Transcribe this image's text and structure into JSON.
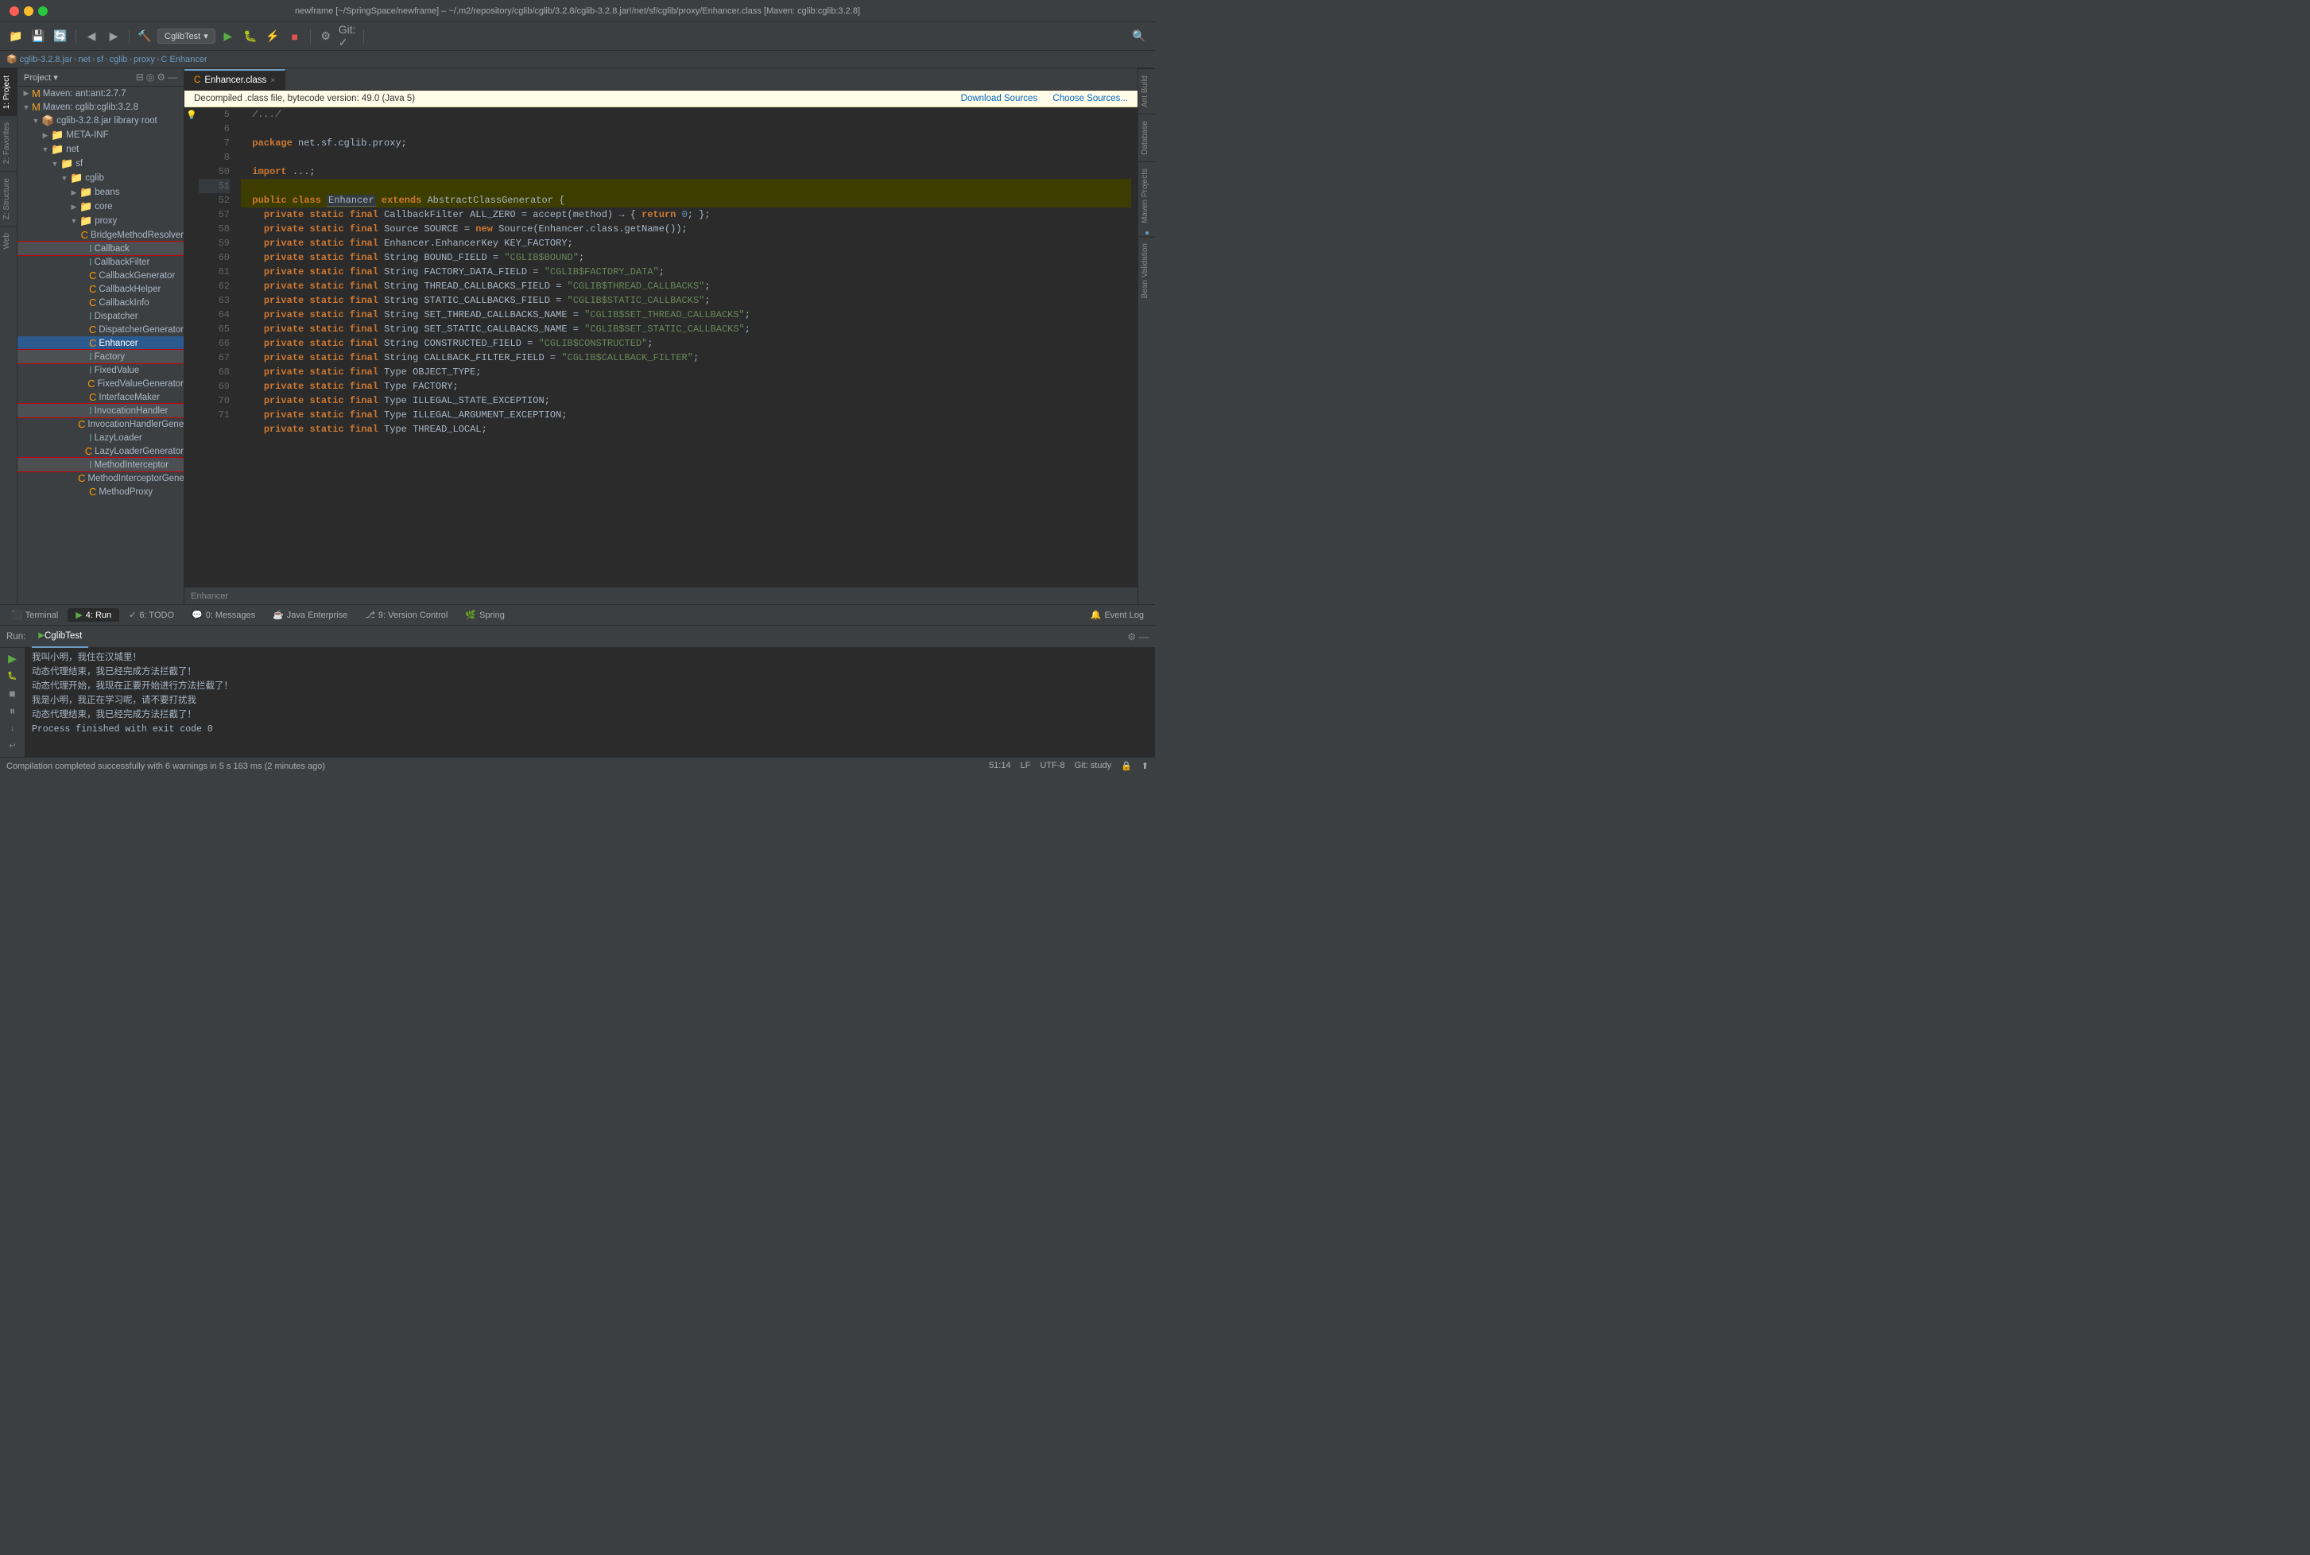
{
  "titleBar": {
    "title": "newframe [~/SpringSpace/newframe] – ~/.m2/repository/cglib/cglib/3.2.8/cglib-3.2.8.jar!/net/sf/cglib/proxy/Enhancer.class [Maven: cglib:cglib:3.2.8]"
  },
  "breadcrumb": {
    "items": [
      "cglib-3.2.8.jar",
      "net",
      "sf",
      "cglib",
      "proxy",
      "Enhancer"
    ]
  },
  "project": {
    "header": "Project",
    "tree": [
      {
        "level": 1,
        "type": "maven",
        "label": "Maven: ant:ant:2.7.7",
        "expanded": false
      },
      {
        "level": 1,
        "type": "maven",
        "label": "Maven: cglib:cglib:3.2.8",
        "expanded": true
      },
      {
        "level": 2,
        "type": "jar",
        "label": "cglib-3.2.8.jar library root",
        "expanded": true
      },
      {
        "level": 3,
        "type": "folder",
        "label": "META-INF",
        "expanded": false
      },
      {
        "level": 3,
        "type": "folder",
        "label": "net",
        "expanded": true
      },
      {
        "level": 4,
        "type": "folder",
        "label": "sf",
        "expanded": true
      },
      {
        "level": 5,
        "type": "folder",
        "label": "cglib",
        "expanded": true
      },
      {
        "level": 6,
        "type": "folder",
        "label": "beans",
        "expanded": false
      },
      {
        "level": 6,
        "type": "folder",
        "label": "core",
        "expanded": false
      },
      {
        "level": 6,
        "type": "folder",
        "label": "proxy",
        "expanded": true
      },
      {
        "level": 7,
        "type": "class",
        "label": "BridgeMethodResolver",
        "expanded": false
      },
      {
        "level": 7,
        "type": "class",
        "label": "Callback",
        "expanded": false,
        "highlighted": true
      },
      {
        "level": 7,
        "type": "class",
        "label": "CallbackFilter",
        "expanded": false
      },
      {
        "level": 7,
        "type": "class",
        "label": "CallbackGenerator",
        "expanded": false
      },
      {
        "level": 7,
        "type": "class",
        "label": "CallbackHelper",
        "expanded": false
      },
      {
        "level": 7,
        "type": "class",
        "label": "CallbackInfo",
        "expanded": false
      },
      {
        "level": 7,
        "type": "class",
        "label": "Dispatcher",
        "expanded": false
      },
      {
        "level": 7,
        "type": "class",
        "label": "DispatcherGenerator",
        "expanded": false
      },
      {
        "level": 7,
        "type": "class",
        "label": "Enhancer",
        "expanded": false,
        "selected": true
      },
      {
        "level": 7,
        "type": "class",
        "label": "Factory",
        "expanded": false,
        "highlighted": true
      },
      {
        "level": 7,
        "type": "class",
        "label": "FixedValue",
        "expanded": false
      },
      {
        "level": 7,
        "type": "class",
        "label": "FixedValueGenerator",
        "expanded": false
      },
      {
        "level": 7,
        "type": "class",
        "label": "InterfaceMaker",
        "expanded": false
      },
      {
        "level": 7,
        "type": "class",
        "label": "InvocationHandler",
        "expanded": false,
        "highlighted": true
      },
      {
        "level": 7,
        "type": "class",
        "label": "InvocationHandlerGenerator",
        "expanded": false
      },
      {
        "level": 7,
        "type": "class",
        "label": "LazyLoader",
        "expanded": false
      },
      {
        "level": 7,
        "type": "class",
        "label": "LazyLoaderGenerator",
        "expanded": false
      },
      {
        "level": 7,
        "type": "class",
        "label": "MethodInterceptor",
        "expanded": false,
        "highlighted": true
      },
      {
        "level": 7,
        "type": "class",
        "label": "MethodInterceptorGenerator",
        "expanded": false
      },
      {
        "level": 7,
        "type": "class",
        "label": "MethodProxy",
        "expanded": false
      }
    ]
  },
  "editor": {
    "tabs": [
      {
        "label": "Enhancer.class",
        "active": true,
        "icon": "class"
      }
    ],
    "notice": {
      "text": "Decompiled .class file, bytecode version: 49.0 (Java 5)",
      "downloadSources": "Download Sources",
      "chooseSources": "Choose Sources..."
    },
    "lines": [
      {
        "num": "",
        "content": "  /.../"
      },
      {
        "num": "5",
        "content": ""
      },
      {
        "num": "6",
        "content": "  package net.sf.cglib.proxy;"
      },
      {
        "num": "7",
        "content": ""
      },
      {
        "num": "8",
        "content": "  import ...;"
      },
      {
        "num": "50",
        "content": ""
      },
      {
        "num": "51",
        "content": "  public class Enhancer extends AbstractClassGenerator {"
      },
      {
        "num": "52",
        "content": "    private static final CallbackFilter ALL_ZERO = accept(method) → { return 0; };"
      },
      {
        "num": "57",
        "content": "    private static final Source SOURCE = new Source(Enhancer.class.getName());"
      },
      {
        "num": "58",
        "content": "    private static final Enhancer.EnhancerKey KEY_FACTORY;"
      },
      {
        "num": "59",
        "content": "    private static final String BOUND_FIELD = \"CGLIB$BOUND\";"
      },
      {
        "num": "60",
        "content": "    private static final String FACTORY_DATA_FIELD = \"CGLIB$FACTORY_DATA\";"
      },
      {
        "num": "61",
        "content": "    private static final String THREAD_CALLBACKS_FIELD = \"CGLIB$THREAD_CALLBACKS\";"
      },
      {
        "num": "62",
        "content": "    private static final String STATIC_CALLBACKS_FIELD = \"CGLIB$STATIC_CALLBACKS\";"
      },
      {
        "num": "63",
        "content": "    private static final String SET_THREAD_CALLBACKS_NAME = \"CGLIB$SET_THREAD_CALLBACKS\";"
      },
      {
        "num": "64",
        "content": "    private static final String SET_STATIC_CALLBACKS_NAME = \"CGLIB$SET_STATIC_CALLBACKS\";"
      },
      {
        "num": "65",
        "content": "    private static final String CONSTRUCTED_FIELD = \"CGLIB$CONSTRUCTED\";"
      },
      {
        "num": "66",
        "content": "    private static final String CALLBACK_FILTER_FIELD = \"CGLIB$CALLBACK_FILTER\";"
      },
      {
        "num": "67",
        "content": "    private static final Type OBJECT_TYPE;"
      },
      {
        "num": "68",
        "content": "    private static final Type FACTORY;"
      },
      {
        "num": "69",
        "content": "    private static final Type ILLEGAL_STATE_EXCEPTION;"
      },
      {
        "num": "70",
        "content": "    private static final Type ILLEGAL_ARGUMENT_EXCEPTION;"
      },
      {
        "num": "71",
        "content": "    private static final Type THREAD_LOCAL;"
      }
    ],
    "breadcrumb": "Enhancer"
  },
  "runPanel": {
    "label": "Run:",
    "tabLabel": "CglibTest",
    "output": [
      "我叫小明，我住在汉城里！",
      "动态代理结束，我已经完成方法拦截了！",
      "动态代理开始，我现在正要开始进行方法拦截了！",
      "我是小明，我正在学习呢，请不要打扰我",
      "动态代理结束，我已经完成方法拦截了！",
      "",
      "Process finished with exit code 0"
    ]
  },
  "bottomTabs": [
    {
      "label": "Terminal",
      "icon": "terminal",
      "active": false
    },
    {
      "label": "4: Run",
      "icon": "run",
      "active": true
    },
    {
      "label": "6: TODO",
      "icon": "todo",
      "active": false
    },
    {
      "label": "0: Messages",
      "icon": "messages",
      "active": false
    },
    {
      "label": "Java Enterprise",
      "icon": "java",
      "active": false
    },
    {
      "label": "9: Version Control",
      "icon": "git",
      "active": false
    },
    {
      "label": "Spring",
      "icon": "spring",
      "active": false
    }
  ],
  "statusBar": {
    "message": "Compilation completed successfully with 6 warnings in 5 s 163 ms (2 minutes ago)",
    "position": "51:14",
    "encoding": "UTF-8",
    "lineSeparator": "LF",
    "vcs": "Git: study"
  },
  "rightPanels": [
    "Ant Build",
    "Database",
    "Maven Projects",
    "Bean Validation"
  ],
  "leftSideTabs": [
    "1: Project",
    "2: Favorites",
    "Z: Structure",
    "Web"
  ]
}
